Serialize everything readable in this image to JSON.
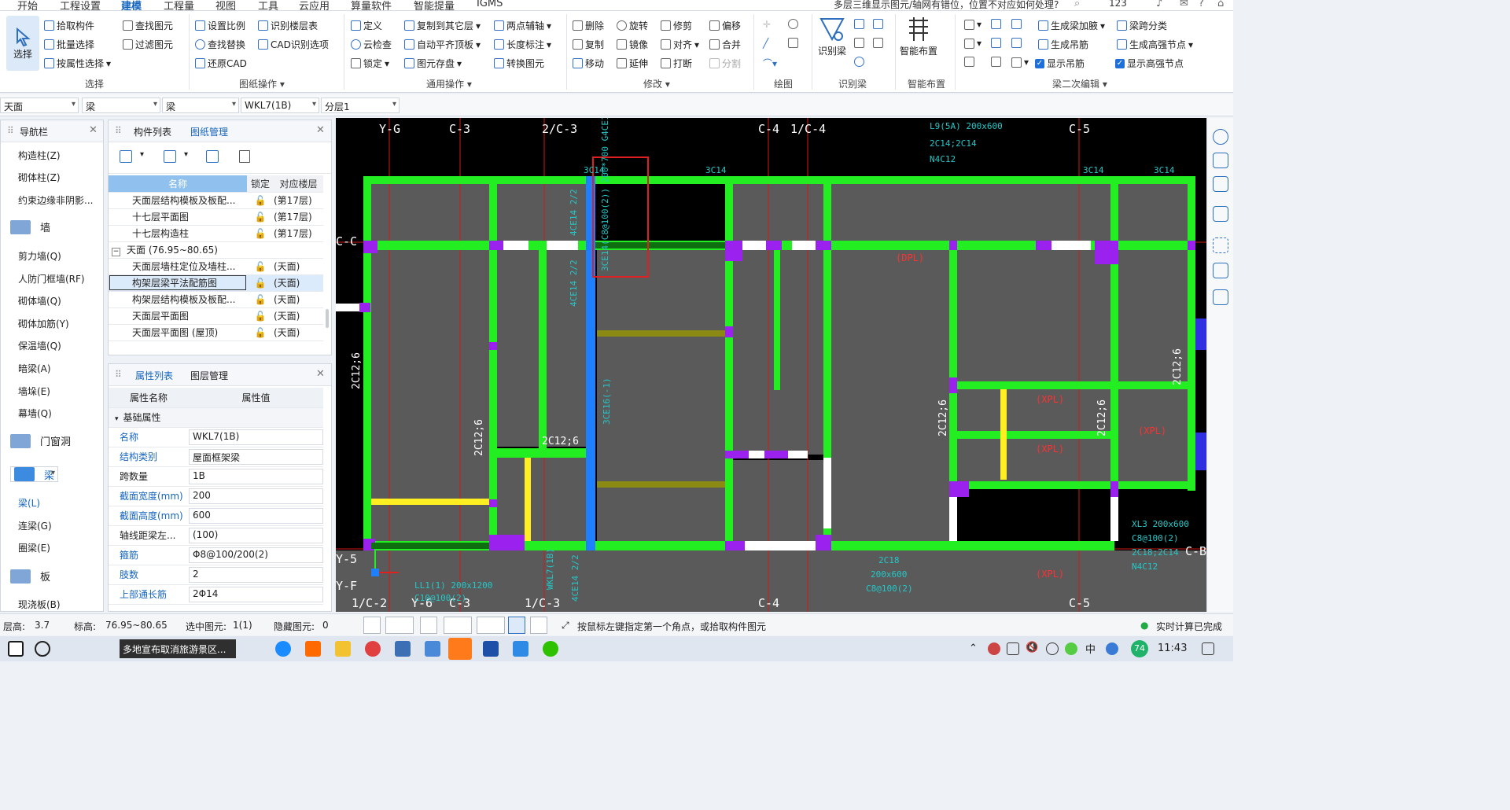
{
  "menu": {
    "items": [
      "开始",
      "工程设置",
      "建模",
      "工程量",
      "视图",
      "工具",
      "云应用",
      "算量软件",
      "智能提量",
      "IGMS"
    ],
    "active": "建模",
    "help_text": "多层三维显示图元/轴网有错位，位置不对应如何处理?",
    "user_count": "123"
  },
  "ribbon": {
    "select": {
      "big": "选择",
      "b1": "拾取构件",
      "b2": "批量选择",
      "b3": "按属性选择",
      "c1": "查找图元",
      "c2": "过滤图元",
      "group": "选择"
    },
    "drawing_ops": {
      "b1": "设置比例",
      "b2": "查找替换",
      "b3": "还原CAD",
      "c1": "识别楼层表",
      "c2": "CAD识别选项",
      "group": "图纸操作"
    },
    "general_ops": {
      "b1": "定义",
      "b2": "云检查",
      "b3": "锁定",
      "c1": "复制到其它层",
      "c2": "自动平齐顶板",
      "c3": "图元存盘",
      "d1": "两点辅轴",
      "d2": "长度标注",
      "d3": "转换图元",
      "group": "通用操作"
    },
    "modify": {
      "b1": "删除",
      "b2": "复制",
      "b3": "移动",
      "c1": "旋转",
      "c2": "镜像",
      "c3": "延伸",
      "d1": "修剪",
      "d2": "对齐",
      "d3": "打断",
      "e1": "偏移",
      "e2": "合并",
      "e3": "分割",
      "group": "修改"
    },
    "draw": {
      "group": "绘图"
    },
    "identify": {
      "big": "识别梁",
      "group": "识别梁"
    },
    "smart": {
      "big": "智能布置",
      "group": "智能布置"
    },
    "beam_edit": {
      "b1": "生成梁加腋",
      "b2": "生成吊筋",
      "b3": "显示吊筋",
      "c1": "梁跨分类",
      "c2": "生成高强节点",
      "c3": "显示高强节点",
      "group": "梁二次编辑"
    }
  },
  "selectors": [
    "天面",
    "梁",
    "梁",
    "WKL7(1B)",
    "分层1"
  ],
  "nav": {
    "title": "导航栏",
    "items_top": [
      "构造柱(Z)",
      "砌体柱(Z)",
      "约束边缘非阴影..."
    ],
    "cat_wall": "墙",
    "items_wall": [
      "剪力墙(Q)",
      "人防门框墙(RF)",
      "砌体墙(Q)",
      "砌体加筋(Y)",
      "保温墙(Q)",
      "暗梁(A)",
      "墙垛(E)",
      "幕墙(Q)"
    ],
    "cat_door": "门窗洞",
    "cat_beam": "梁",
    "items_beam": [
      "梁(L)",
      "连梁(G)",
      "圈梁(E)"
    ],
    "cat_slab": "板",
    "items_slab": [
      "现浇板(B)"
    ]
  },
  "drawings": {
    "tab1": "构件列表",
    "tab2": "图纸管理",
    "headers": [
      "名称",
      "锁定",
      "对应楼层"
    ],
    "rows": [
      {
        "name": "天面层结构模板及板配...",
        "floor": "(第17层)"
      },
      {
        "name": "十七层平面图",
        "floor": "(第17层)"
      },
      {
        "name": "十七层构造柱",
        "floor": "(第17层)"
      },
      {
        "name": "天面 (76.95~80.65)",
        "floor": ""
      },
      {
        "name": "天面层墙柱定位及墙柱...",
        "floor": "(天面)"
      },
      {
        "name": "构架层梁平法配筋图",
        "floor": "(天面)"
      },
      {
        "name": "构架层结构模板及板配...",
        "floor": "(天面)"
      },
      {
        "name": "天面层平面图",
        "floor": "(天面)"
      },
      {
        "name": "天面层平面图 (屋顶)",
        "floor": "(天面)"
      }
    ]
  },
  "props": {
    "tab1": "属性列表",
    "tab2": "图层管理",
    "headers": [
      "属性名称",
      "属性值"
    ],
    "section": "基础属性",
    "rows": [
      {
        "name": "名称",
        "value": "WKL7(1B)"
      },
      {
        "name": "结构类别",
        "value": "屋面框架梁"
      },
      {
        "name": "跨数量",
        "value": "1B"
      },
      {
        "name": "截面宽度(mm)",
        "value": "200"
      },
      {
        "name": "截面高度(mm)",
        "value": "600"
      },
      {
        "name": "轴线距梁左...",
        "value": "(100)"
      },
      {
        "name": "箍筋",
        "value": "Φ8@100/200(2)"
      },
      {
        "name": "肢数",
        "value": "2"
      },
      {
        "name": "上部通长筋",
        "value": "2Φ14"
      }
    ]
  },
  "cad": {
    "axes_top": [
      "Y-G",
      "C-3",
      "2/C-3",
      "C-4",
      "1/C-4",
      "C-5"
    ],
    "axes_bottom": [
      "1/C-2",
      "Y-6",
      "C-3",
      "1/C-3",
      "C-4",
      "C-5"
    ],
    "axes_left": [
      "C-C",
      "Y-5",
      "Y-F"
    ],
    "axes_right": [
      "C-B"
    ],
    "labels": {
      "t1": "L9(5A) 200x600",
      "t2": "2C14;2C14",
      "t3": "N4C12",
      "t4": "3C14",
      "t5": "3C14",
      "t6": "3C14",
      "t7": "3C14",
      "rb": "3CE14(C8@100(2)) 200*700 G4CE10",
      "v1": "4CE14 2/2",
      "v2": "4CE14 2/2",
      "v3": "3CE16(-1)",
      "dpl1": "(DPL)",
      "xpl1": "(XPL)",
      "xpl2": "(XPL)",
      "xpl3": "(XPL)",
      "xpl4": "(XPL)",
      "s1": "2C12;6",
      "s2": "2C12;6",
      "s3": "2C12;6",
      "s4": "2C12;6",
      "s5": "2C12;6",
      "s6": "2C12;6",
      "b1": "LL1(1) 200x1200",
      "b2": "C10@100(2)",
      "b3": "WKL7(1B)",
      "b4": "2C18",
      "b5": "200x600",
      "b6": "C8@100(2)",
      "r1": "XL3 200x600",
      "r2": "C8@100(2)",
      "r3": "2C18;2C14",
      "r4": "N4C12"
    }
  },
  "status": {
    "floor_h_label": "层高:",
    "floor_h": "3.7",
    "elev_label": "标高:",
    "elev": "76.95~80.65",
    "sel_label": "选中图元:",
    "sel": "1(1)",
    "hidden_label": "隐藏图元:",
    "hidden": "0",
    "hint": "按鼠标左键指定第一个角点，或拾取构件图元",
    "calc": "实时计算已完成"
  },
  "taskbar": {
    "news": "多地宣布取消旅游景区...",
    "badge": "74",
    "ime": "中",
    "time": "11:43"
  }
}
